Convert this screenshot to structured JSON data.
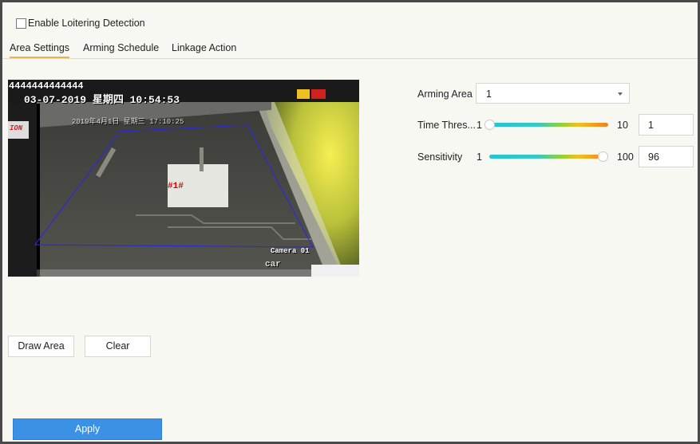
{
  "enable_checkbox": {
    "label": "Enable Loitering Detection",
    "checked": false
  },
  "tabs": [
    {
      "label": "Area Settings",
      "active": true
    },
    {
      "label": "Arming Schedule",
      "active": false
    },
    {
      "label": "Linkage Action",
      "active": false
    }
  ],
  "video": {
    "osd_top": "4444444444444",
    "osd_datetime": "03-07-2019 星期四 10:54:53",
    "osd_inner_datetime": "2019年4月1日 星期三 17:10:25",
    "osd_camera": "Camera 01",
    "area_label": "#1#",
    "brand_strip": "ION",
    "road_text": "car"
  },
  "arming_area": {
    "label": "Arming Area",
    "value": "1"
  },
  "time_threshold": {
    "label": "Time Thres...",
    "min": "1",
    "max": "10",
    "value": "1"
  },
  "sensitivity": {
    "label": "Sensitivity",
    "min": "1",
    "max": "100",
    "value": "96"
  },
  "buttons": {
    "draw_area": "Draw Area",
    "clear": "Clear",
    "apply": "Apply"
  },
  "colors": {
    "accent": "#3b91e6",
    "tab_underline": "#e9b44c",
    "area_polygon": "#2b2bd6"
  }
}
